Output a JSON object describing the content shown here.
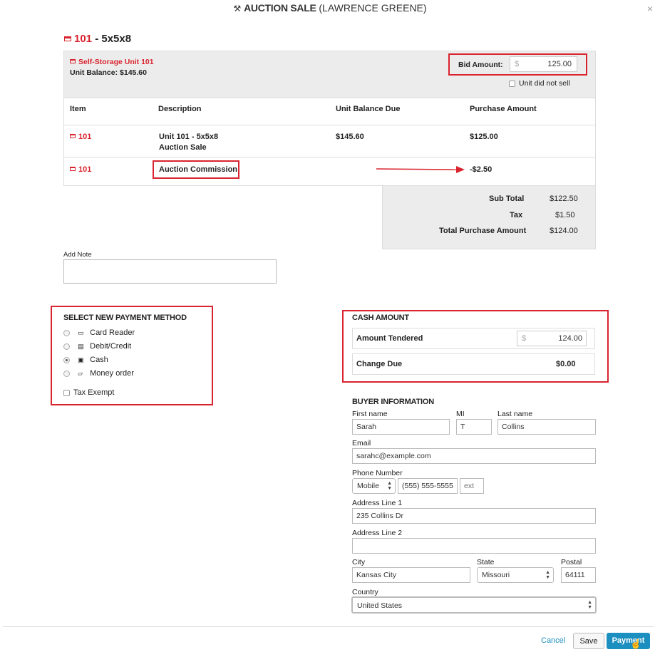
{
  "header": {
    "title_bold": "AUCTION SALE",
    "title_rest": "(LAWRENCE GREENE)",
    "close": "×"
  },
  "unit": {
    "heading_num": "101",
    "heading_rest": "- 5x5x8",
    "name": "Self-Storage Unit 101",
    "balance": "Unit Balance: $145.60"
  },
  "bid": {
    "label": "Bid Amount:",
    "currency": "$",
    "value": "125.00",
    "not_sell_label": "Unit did not sell"
  },
  "table": {
    "headers": [
      "Item",
      "Description",
      "Unit Balance Due",
      "Purchase Amount"
    ],
    "rows": [
      {
        "item": "101",
        "desc1": "Unit 101 - 5x5x8",
        "desc2": "Auction Sale",
        "balance": "$145.60",
        "purchase": "$125.00"
      },
      {
        "item": "101",
        "desc1": "Auction Commission",
        "balance": "",
        "purchase": "-$2.50"
      }
    ]
  },
  "totals": {
    "subtotal_label": "Sub Total",
    "subtotal": "$122.50",
    "tax_label": "Tax",
    "tax": "$1.50",
    "total_label": "Total Purchase Amount",
    "total": "$124.00"
  },
  "note": {
    "label": "Add Note"
  },
  "payment": {
    "title": "SELECT NEW PAYMENT METHOD",
    "options": [
      "Card Reader",
      "Debit/Credit",
      "Cash",
      "Money order"
    ],
    "selected": "Cash",
    "tax_exempt": "Tax Exempt"
  },
  "cash": {
    "title": "CASH AMOUNT",
    "tendered_label": "Amount Tendered",
    "currency": "$",
    "tendered": "124.00",
    "change_label": "Change Due",
    "change": "$0.00"
  },
  "buyer": {
    "title": "BUYER INFORMATION",
    "first_label": "First name",
    "first": "Sarah",
    "mi_label": "MI",
    "mi": "T",
    "last_label": "Last name",
    "last": "Collins",
    "email_label": "Email",
    "email": "sarahc@example.com",
    "phone_label": "Phone Number",
    "phone_type": "Mobile",
    "phone": "(555) 555-5555",
    "ext_placeholder": "ext",
    "addr1_label": "Address Line 1",
    "addr1": "235 Collins Dr",
    "addr2_label": "Address Line 2",
    "addr2": "",
    "city_label": "City",
    "city": "Kansas City",
    "state_label": "State",
    "state": "Missouri",
    "postal_label": "Postal",
    "postal": "64111",
    "country_label": "Country",
    "country": "United States"
  },
  "footer": {
    "cancel": "Cancel",
    "save": "Save",
    "payment": "Payment"
  },
  "colors": {
    "accent_red": "#d9232e",
    "primary_button": "#1b8fc0"
  }
}
